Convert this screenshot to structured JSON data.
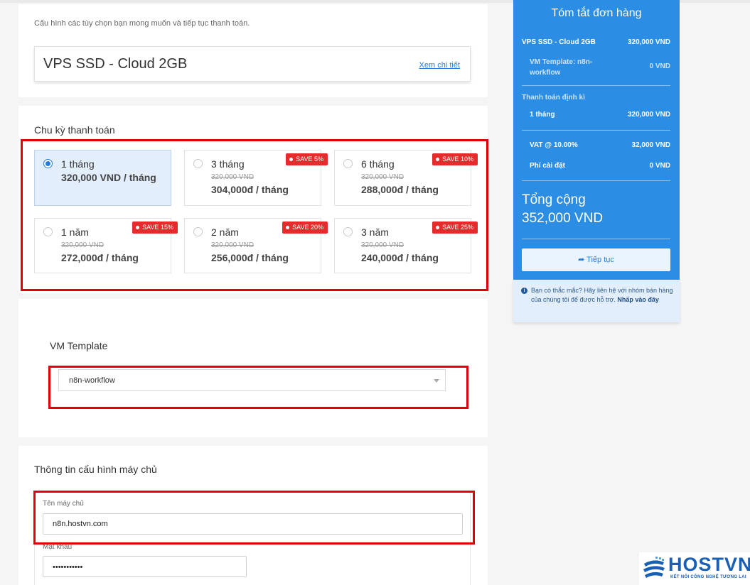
{
  "intro": {
    "text": "Cấu hình các tùy chọn bạn mong muốn và tiếp tục thanh toán.",
    "product_name": "VPS SSD - Cloud 2GB",
    "details_link": "Xem chi tiết"
  },
  "billing": {
    "title": "Chu kỳ thanh toán",
    "options": [
      {
        "label": "1 tháng",
        "price": "320,000 VND / tháng",
        "selected": true
      },
      {
        "label": "3 tháng",
        "old_price": "320,000 VND",
        "price": "304,000đ / tháng",
        "badge": "SAVE 5%"
      },
      {
        "label": "6 tháng",
        "old_price": "320,000 VND",
        "price": "288,000đ / tháng",
        "badge": "SAVE 10%"
      },
      {
        "label": "1 năm",
        "old_price": "320,000 VND",
        "price": "272,000đ / tháng",
        "badge": "SAVE 15%"
      },
      {
        "label": "2 năm",
        "old_price": "320,000 VND",
        "price": "256,000đ / tháng",
        "badge": "SAVE 20%"
      },
      {
        "label": "3 năm",
        "old_price": "320,000 VND",
        "price": "240,000đ / tháng",
        "badge": "SAVE 25%"
      }
    ]
  },
  "template": {
    "title": "VM Template",
    "selected": "n8n-workflow"
  },
  "server": {
    "title": "Thông tin cấu hình máy chủ",
    "hostname_label": "Tên máy chủ",
    "hostname_value": "n8n.hostvn.com",
    "password_label": "Mật khẩu",
    "password_value": "•••••••••••"
  },
  "summary": {
    "title": "Tóm tắt đơn hàng",
    "product": "VPS SSD - Cloud 2GB",
    "product_price": "320,000 VND",
    "template_label": "VM Template: n8n-workflow",
    "template_price": "0 VND",
    "recurring_label": "Thanh toán định kì",
    "period": "1 tháng",
    "period_price": "320,000 VND",
    "vat_label": "VAT @ 10.00%",
    "vat_value": "32,000 VND",
    "setup_label": "Phí cài đặt",
    "setup_value": "0 VND",
    "total_label": "Tổng cộng",
    "total_value": "352,000 VND",
    "continue_label": "Tiếp tục"
  },
  "help": {
    "text": "Bạn có thắc mắc? Hãy liên hệ với nhóm bán hàng của chúng tôi để được hỗ trợ.",
    "link": "Nhấp vào đây"
  },
  "logo": {
    "name": "HOSTVN",
    "tagline": "KẾT NỐI CÔNG NGHỆ TƯƠNG LAI"
  },
  "colors": {
    "accent": "#2b8de3",
    "badge": "#e42c2c",
    "highlight_border": "#e0000b"
  }
}
